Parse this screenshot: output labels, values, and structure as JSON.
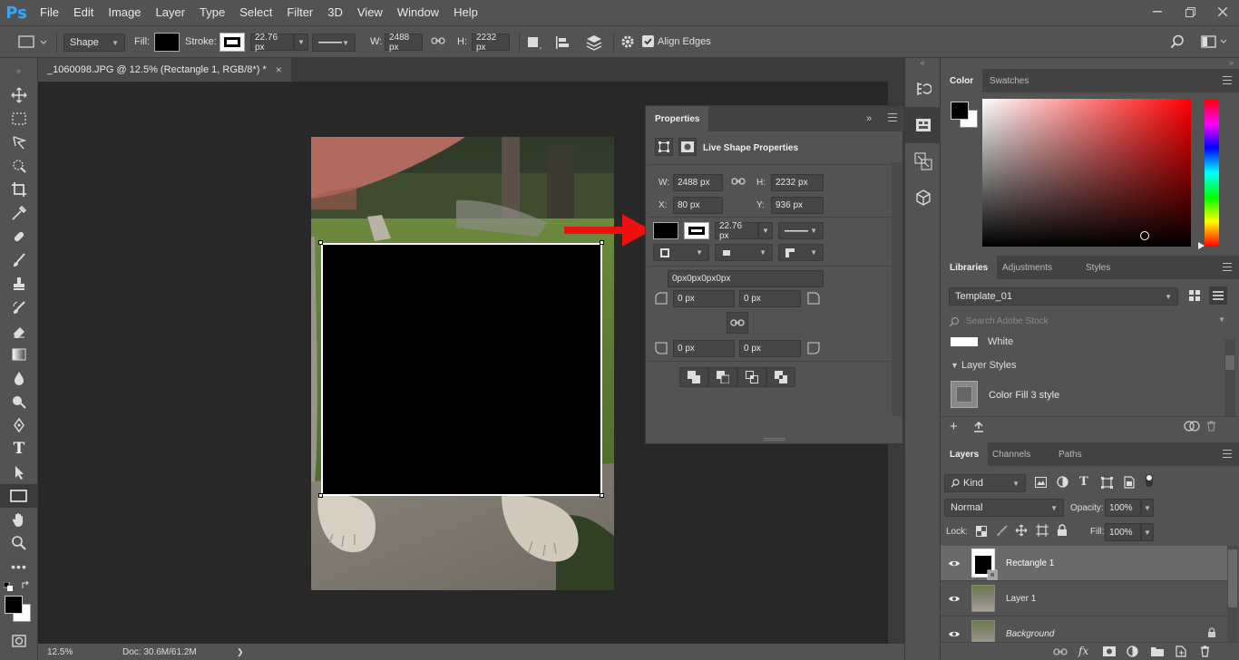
{
  "app": {
    "logo": "Ps"
  },
  "menu": [
    "File",
    "Edit",
    "Image",
    "Layer",
    "Type",
    "Select",
    "Filter",
    "3D",
    "View",
    "Window",
    "Help"
  ],
  "window_controls": [
    "minimize-icon",
    "restore-icon",
    "close-icon"
  ],
  "options": {
    "mode": "Shape",
    "fill_label": "Fill:",
    "stroke_label": "Stroke:",
    "stroke_width": "22.76 px",
    "w_label": "W:",
    "w_value": "2488 px",
    "h_label": "H:",
    "h_value": "2232 px",
    "align_edges": "Align Edges",
    "align_edges_checked": true
  },
  "document": {
    "tab_title": "_1060098.JPG @ 12.5% (Rectangle 1, RGB/8*) *",
    "close": "×"
  },
  "status": {
    "zoom": "12.5%",
    "doc": "Doc: 30.6M/61.2M",
    "arrow": "❯"
  },
  "properties": {
    "tab": "Properties",
    "section_title": "Live Shape Properties",
    "w_label": "W:",
    "w_value": "2488 px",
    "h_label": "H:",
    "h_value": "2232 px",
    "x_label": "X:",
    "x_value": "80 px",
    "y_label": "Y:",
    "y_value": "936 px",
    "stroke_width": "22.76 px",
    "corner_all": "0px0px0px0px",
    "corner_tl": "0 px",
    "corner_tr": "0 px",
    "corner_bl": "0 px",
    "corner_br": "0 px"
  },
  "color_panel": {
    "tabs": [
      "Color",
      "Swatches"
    ],
    "hue_color": "#ff0000"
  },
  "libraries": {
    "tabs": [
      "Libraries",
      "Adjustments",
      "Styles"
    ],
    "library_name": "Template_01",
    "search_placeholder": "Search Adobe Stock",
    "white_item": "White",
    "group_title": "Layer Styles",
    "style_item": "Color Fill 3 style"
  },
  "layers": {
    "tabs": [
      "Layers",
      "Channels",
      "Paths"
    ],
    "filter": "Kind",
    "blend_mode": "Normal",
    "opacity_label": "Opacity:",
    "opacity_value": "100%",
    "lock_label": "Lock:",
    "fill_label": "Fill:",
    "fill_value": "100%",
    "items": [
      {
        "name": "Rectangle 1",
        "selected": true
      },
      {
        "name": "Layer 1",
        "selected": false
      },
      {
        "name": "Background",
        "selected": false
      }
    ]
  }
}
